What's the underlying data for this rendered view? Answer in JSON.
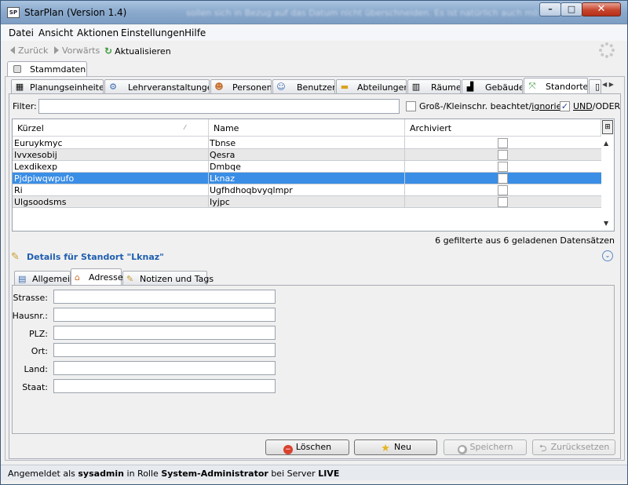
{
  "window": {
    "title": "StarPlan (Version 1.4)",
    "background_text": "sollen sich in Bezug auf das Datum nicht überschneiden. Es ist natürlich auch mö"
  },
  "menu": [
    "Datei",
    "Ansicht",
    "Aktionen",
    "Einstellungen",
    "Hilfe"
  ],
  "toolbar": {
    "back": "Zurück",
    "forward": "Vorwärts",
    "refresh": "Aktualisieren"
  },
  "outer_tab": "Stammdaten",
  "tabs": [
    {
      "label": "Planungseinheiten",
      "icon": "grid-icon"
    },
    {
      "label": "Lehrveranstaltungen",
      "icon": "course-icon"
    },
    {
      "label": "Personen",
      "icon": "person-icon"
    },
    {
      "label": "Benutzer",
      "icon": "user-icon"
    },
    {
      "label": "Abteilungen",
      "icon": "folder-icon"
    },
    {
      "label": "Räume",
      "icon": "room-icon"
    },
    {
      "label": "Gebäude",
      "icon": "building-icon"
    },
    {
      "label": "Standorte",
      "icon": "location-icon",
      "selected": true
    }
  ],
  "filter": {
    "label": "Filter:",
    "value": "",
    "case_label_a": "Groß-/Kleinschr. beachtet/",
    "case_label_b": "ignoriert",
    "case_checked": false,
    "und_label": "UND",
    "oder_label": "/ODER",
    "und_checked": true
  },
  "table": {
    "columns": [
      "Kürzel",
      "Name",
      "Archiviert"
    ],
    "rows": [
      {
        "kuerzel": "Euruykmyc",
        "name": "Tbnse",
        "archiviert": false
      },
      {
        "kuerzel": "Ivvxesobij",
        "name": "Qesra",
        "archiviert": false
      },
      {
        "kuerzel": "Lexdikexp",
        "name": "Dmbqe",
        "archiviert": false
      },
      {
        "kuerzel": "Pjdpiwqwpufo",
        "name": "Lknaz",
        "archiviert": false,
        "selected": true
      },
      {
        "kuerzel": "Ri",
        "name": "Ugfhdhoqbvyqlmpr",
        "archiviert": false
      },
      {
        "kuerzel": "Ulgsoodsms",
        "name": "Iyjpc",
        "archiviert": false
      }
    ],
    "count_text": "6 gefilterte aus 6 geladenen Datensätzen"
  },
  "details": {
    "title": "Details für Standort \"Lknaz\"",
    "tabs": [
      "Allgemein",
      "Adresse",
      "Notizen und Tags"
    ],
    "selected_tab": "Adresse",
    "fields": [
      {
        "label": "Strasse:",
        "value": ""
      },
      {
        "label": "Hausnr.:",
        "value": ""
      },
      {
        "label": "PLZ:",
        "value": ""
      },
      {
        "label": "Ort:",
        "value": ""
      },
      {
        "label": "Land:",
        "value": ""
      },
      {
        "label": "Staat:",
        "value": ""
      }
    ]
  },
  "buttons": {
    "delete": "Löschen",
    "new": "Neu",
    "save": "Speichern",
    "reset": "Zurücksetzen"
  },
  "status": {
    "prefix": "Angemeldet als",
    "user": "sysadmin",
    "role_prefix": "in Rolle",
    "role": "System-Administrator",
    "server_prefix": "bei Server",
    "server": "LIVE"
  },
  "colors": {
    "selection": "#3a8ee6",
    "details_title": "#1f5eb0"
  }
}
